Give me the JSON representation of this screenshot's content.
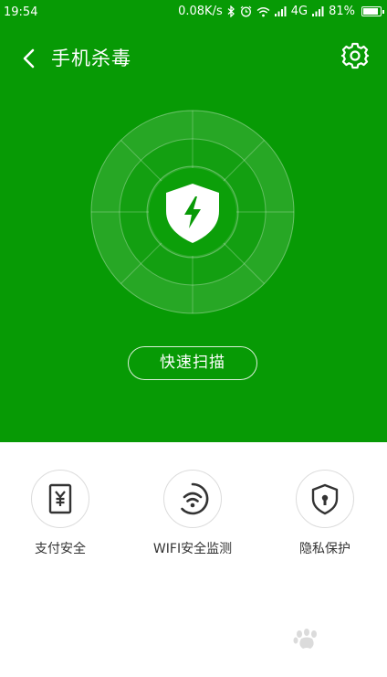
{
  "status": {
    "time": "19:54",
    "speed": "0.08K/s",
    "network": "4G",
    "battery": "81%"
  },
  "header": {
    "title": "手机杀毒"
  },
  "main": {
    "scan_button": "快速扫描"
  },
  "features": [
    {
      "label": "支付安全",
      "icon": "payment-security-icon"
    },
    {
      "label": "WIFI安全监测",
      "icon": "wifi-security-icon"
    },
    {
      "label": "隐私保护",
      "icon": "privacy-lock-icon"
    }
  ],
  "colors": {
    "brand_green": "#079a05",
    "icon_dark": "#333333"
  }
}
